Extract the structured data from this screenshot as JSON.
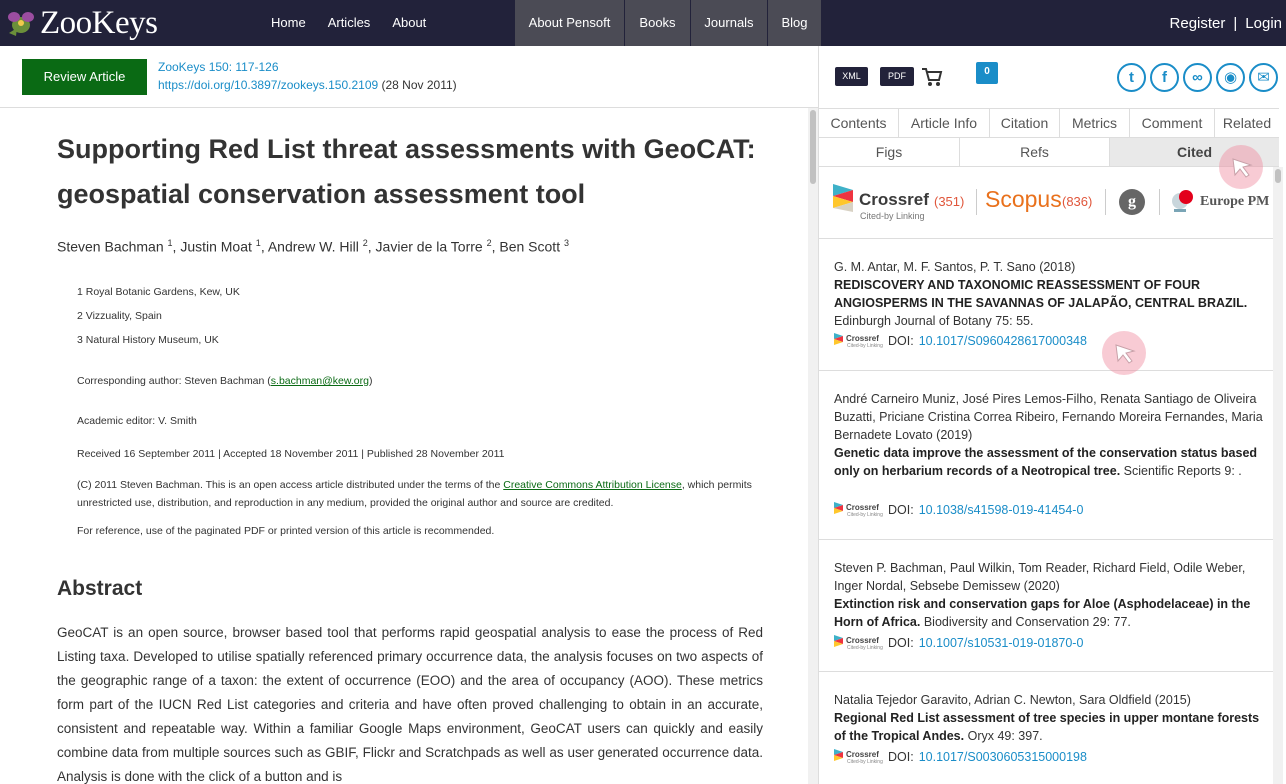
{
  "nav": {
    "logo_text": "ZooKeys",
    "links": [
      "Home",
      "Articles",
      "About"
    ],
    "grey_links": [
      "About Pensoft",
      "Books",
      "Journals",
      "Blog"
    ],
    "register": "Register",
    "separator": "|",
    "login": "Login"
  },
  "article_header": {
    "review_button": "Review Article",
    "journal_ref": "ZooKeys 150: 117-126",
    "doi_url": "https://doi.org/10.3897/zookeys.150.2109",
    "date": " (28 Nov 2011)"
  },
  "article": {
    "title": "Supporting Red List threat assessments with GeoCAT: geospatial conservation assessment tool",
    "authors": [
      {
        "name": "Steven Bachman",
        "sup": "1"
      },
      {
        "name": "Justin Moat",
        "sup": "1"
      },
      {
        "name": "Andrew W. Hill",
        "sup": "2"
      },
      {
        "name": "Javier de la Torre",
        "sup": "2"
      },
      {
        "name": "Ben Scott",
        "sup": "3"
      }
    ],
    "affiliations": [
      "1 Royal Botanic Gardens, Kew, UK",
      "2 Vizzuality, Spain",
      "3 Natural History Museum, UK"
    ],
    "corresponding_prefix": "Corresponding author: Steven Bachman (",
    "corresponding_email": "s.bachman@kew.org",
    "corresponding_suffix": ")",
    "editor": "Academic editor: V. Smith",
    "dates": "Received 16 September 2011 | Accepted 18 November 2011 | Published 28 November 2011",
    "license_prefix": "(C) 2011 Steven Bachman. This is an open access article distributed under the terms of the ",
    "license_link": "Creative Commons Attribution License",
    "license_suffix": ", which permits unrestricted use, distribution, and reproduction in any medium, provided the original author and source are credited.",
    "reference_note": "For reference, use of the paginated PDF or printed version of this article is recommended.",
    "abstract_heading": "Abstract",
    "abstract_text": "GeoCAT is an open source, browser based tool that performs rapid geospatial analysis to ease the process of Red Listing taxa. Developed to utilise spatially referenced primary occurrence data, the analysis focuses on two aspects of the geographic range of a taxon: the extent of occurrence (EOO) and the area of occupancy (AOO). These metrics form part of the IUCN Red List categories and criteria and have often proved challenging to obtain in an accurate, consistent and repeatable way. Within a familiar Google Maps environment, GeoCAT users can quickly and easily combine data from multiple sources such as GBIF, Flickr and Scratchpads as well as user generated occurrence data. Analysis is done with the click of a button and is"
  },
  "panel": {
    "xml": "XML",
    "pdf": "PDF",
    "comment_count": "0",
    "share_icons": [
      "twitter-icon",
      "facebook-icon",
      "mendeley-icon",
      "reddit-icon",
      "email-icon"
    ],
    "tabs_row1": [
      "Contents",
      "Article Info",
      "Citation",
      "Metrics",
      "Comment",
      "Related"
    ],
    "tabs_row2": [
      "Figs",
      "Refs",
      "Cited"
    ],
    "active_tab": "Cited",
    "sources": {
      "crossref_name": "Crossref",
      "crossref_sub": "Cited-by Linking",
      "crossref_count": "(351)",
      "scopus_name": "Scopus",
      "scopus_count": "(836)",
      "google_scholar": "g",
      "europe_pmc": "Europe PM"
    },
    "doi_label": "DOI:",
    "citations": [
      {
        "authors": "G. M. Antar, M. F. Santos, P. T. Sano (2018)",
        "title": "REDISCOVERY AND TAXONOMIC REASSESSMENT OF FOUR ANGIOSPERMS IN THE SAVANNAS OF JALAPÃO, CENTRAL BRAZIL.",
        "journal": "Edinburgh Journal of Botany 75: 55.",
        "doi": "10.1017/S0960428617000348"
      },
      {
        "authors": "André Carneiro Muniz, José Pires Lemos-Filho, Renata Santiago de Oliveira Buzatti, Priciane Cristina Correa Ribeiro, Fernando Moreira Fernandes, Maria Bernadete Lovato (2019)",
        "title": "Genetic data improve the assessment of the conservation status based only on herbarium records of a Neotropical tree.",
        "journal": "Scientific Reports 9: .",
        "doi": "10.1038/s41598-019-41454-0"
      },
      {
        "authors": "Steven P. Bachman, Paul Wilkin, Tom Reader, Richard Field, Odile Weber, Inger Nordal, Sebsebe Demissew (2020)",
        "title": "Extinction risk and conservation gaps for Aloe (Asphodelaceae) in the Horn of Africa.",
        "journal": "Biodiversity and Conservation 29: 77.",
        "doi": "10.1007/s10531-019-01870-0"
      },
      {
        "authors": "Natalia Tejedor Garavito, Adrian C. Newton, Sara Oldfield (2015)",
        "title": "Regional Red List assessment of tree species in upper montane forests of the Tropical Andes.",
        "journal": "Oryx 49: 397.",
        "doi": "10.1017/S0030605315000198"
      }
    ]
  },
  "colors": {
    "topbar": "#22223a",
    "accent_green": "#0a6a14",
    "link_blue": "#1a8dc8",
    "scopus_orange": "#e9711c"
  }
}
